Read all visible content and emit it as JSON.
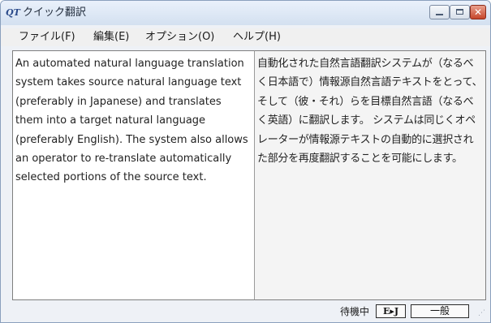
{
  "window": {
    "title": "クイック翻訳",
    "app_icon": "QT",
    "controls": {
      "minimize": "minimize-icon",
      "maximize": "maximize-icon",
      "close": "close-icon",
      "close_glyph": "✕"
    }
  },
  "menu": {
    "items": [
      {
        "label": "ファイル(F)"
      },
      {
        "label": "編集(E)"
      },
      {
        "label": "オプション(O)"
      },
      {
        "label": "ヘルプ(H)"
      }
    ]
  },
  "source_pane": {
    "text": "An automated natural language translation system takes source natural language text (preferably in Japanese) and translates them into a target natural language (preferably English). The system also allows an operator to re-translate automatically selected portions of the source text."
  },
  "target_pane": {
    "text": "自動化された自然言語翻訳システムが（なるべく日本語で）情報源自然言語テキストをとって、そして（彼・それ）らを目標自然言語（なるべく英語）に翻訳します。 システムは同じくオペレーターが情報源テキストの自動的に選択された部分を再度翻訳することを可能にします。"
  },
  "status": {
    "state": "待機中",
    "direction": "E▸J",
    "field": "一般"
  },
  "colors": {
    "title_bar": "#dbe6f4",
    "close_button": "#c6462b",
    "target_pane_bg": "#f4f4f4"
  }
}
